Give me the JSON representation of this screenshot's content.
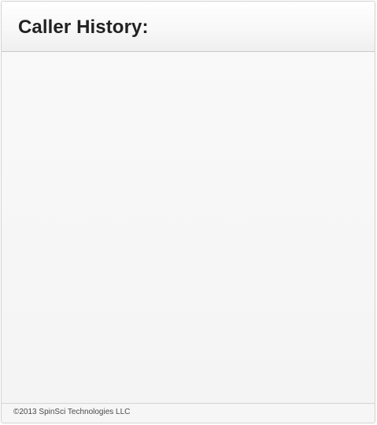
{
  "panel": {
    "title": "Caller History:",
    "footer_text": "©2013 SpinSci Technologies LLC"
  }
}
